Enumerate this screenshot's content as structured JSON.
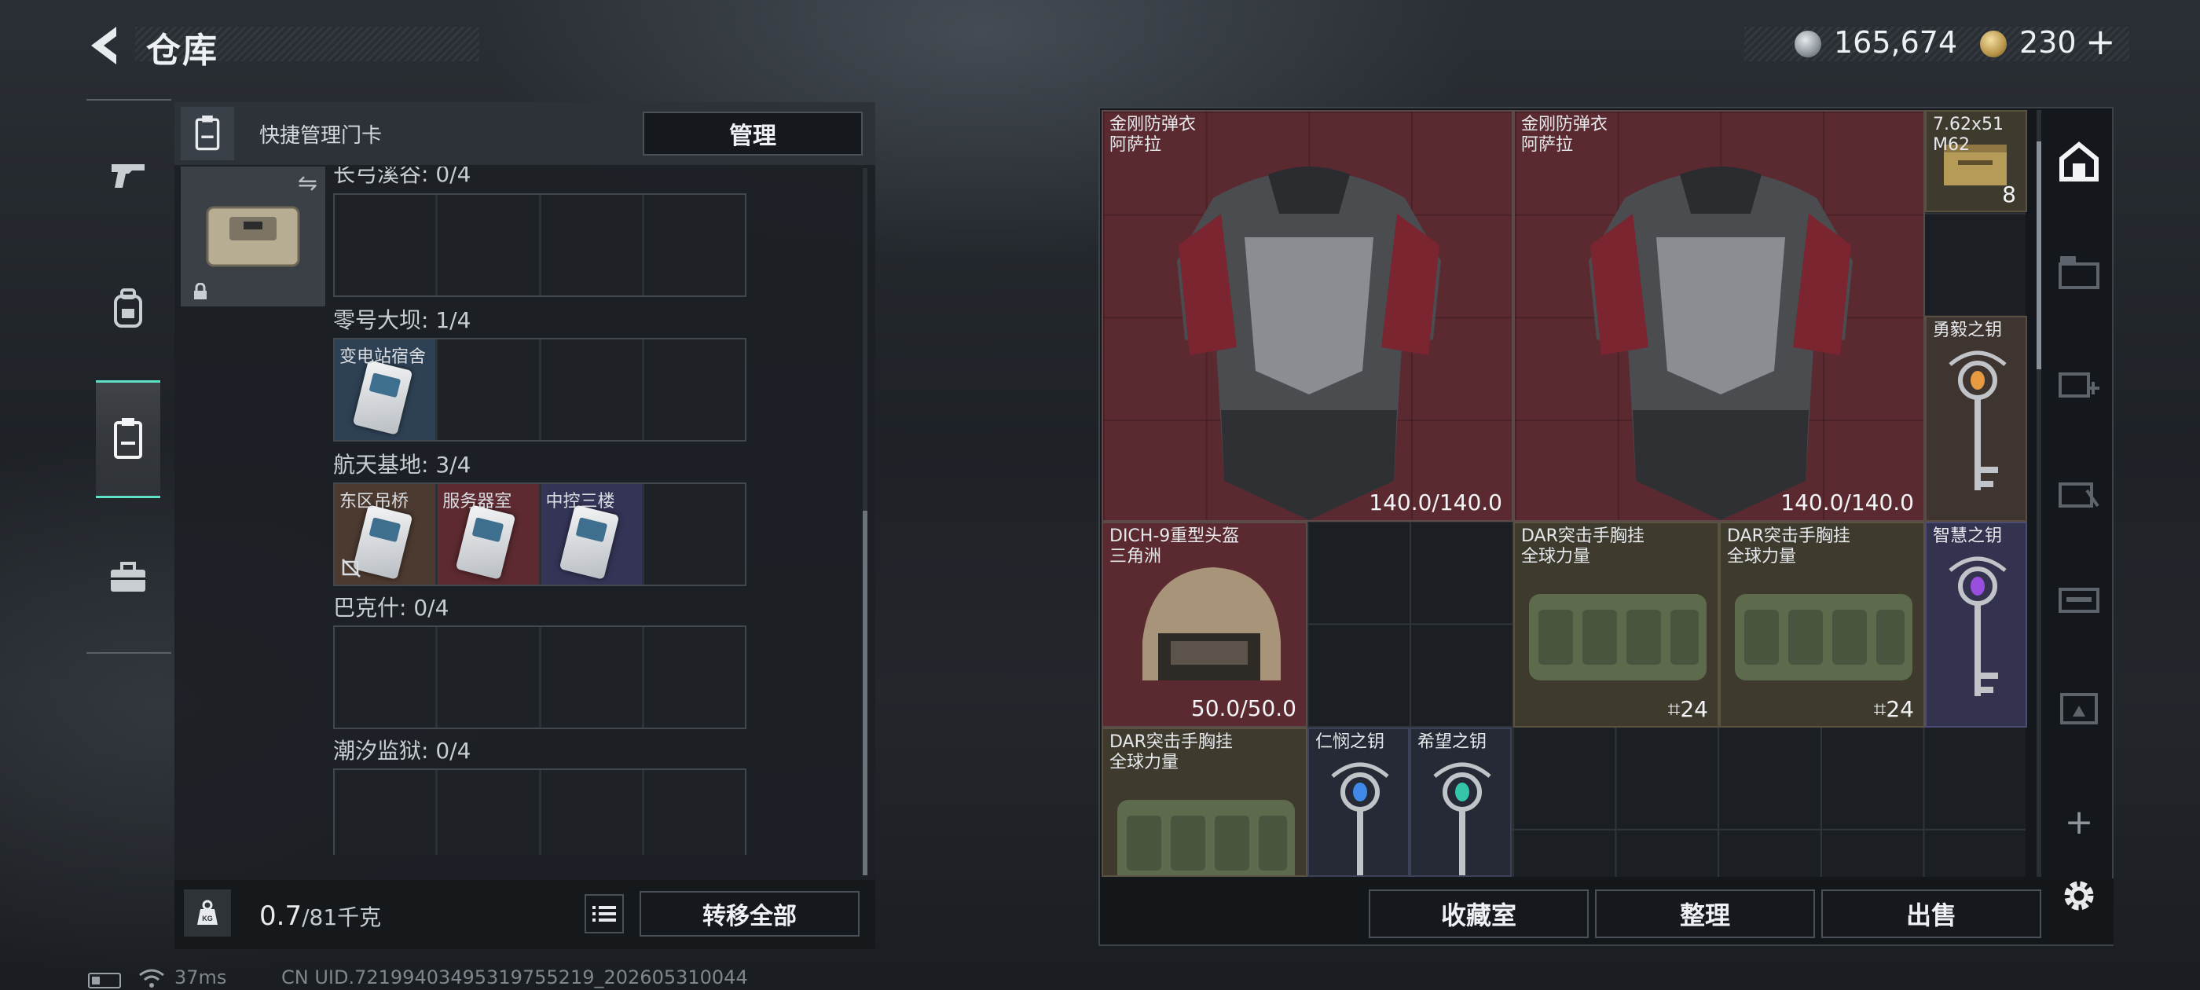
{
  "header": {
    "title": "仓库",
    "currency": [
      {
        "icon": "silver-coin-icon",
        "value": "165,674"
      },
      {
        "icon": "gold-coin-icon",
        "value": "230"
      }
    ],
    "plus": "+"
  },
  "left_tabs": [
    "pistol-icon",
    "backpack-icon",
    "keycard-icon",
    "briefcase-icon"
  ],
  "storage": {
    "header_label": "快捷管理门卡",
    "manage_label": "管理",
    "regions": [
      {
        "label": "长弓溪谷: 0/4",
        "slots": []
      },
      {
        "label": "零号大坝: 1/4",
        "slots": [
          {
            "name": "变电站宿舍",
            "color": "keycard"
          }
        ]
      },
      {
        "label": "航天基地: 3/4",
        "slots": [
          {
            "name": "东区吊桥",
            "color": "brown"
          },
          {
            "name": "服务器室",
            "color": "red"
          },
          {
            "name": "中控三楼",
            "color": "purple"
          }
        ]
      },
      {
        "label": "巴克什: 0/4",
        "slots": []
      },
      {
        "label": "潮汐监狱: 0/4",
        "slots": []
      }
    ],
    "weight_value": "0.7",
    "weight_unit": "/81千克",
    "transfer_label": "转移全部"
  },
  "inventory": {
    "items": [
      {
        "name1": "金刚防弹衣",
        "name2": "阿萨拉",
        "durability": "140.0/140.0"
      },
      {
        "name1": "金刚防弹衣",
        "name2": "阿萨拉",
        "durability": "140.0/140.0"
      },
      {
        "name1": "7.62x51",
        "name2": "M62",
        "count": "8"
      },
      {
        "name1": "勇毅之钥"
      },
      {
        "name1": "DICH-9重型头盔",
        "name2": "三角洲",
        "durability": "50.0/50.0"
      },
      {
        "name1": "DAR突击手胸挂",
        "name2": "全球力量",
        "count": "24"
      },
      {
        "name1": "DAR突击手胸挂",
        "name2": "全球力量",
        "count": "24"
      },
      {
        "name1": "智慧之钥"
      },
      {
        "name1": "DAR突击手胸挂",
        "name2": "全球力量"
      },
      {
        "name1": "仁悯之钥"
      },
      {
        "name1": "希望之钥"
      }
    ],
    "buttons": {
      "collection": "收藏室",
      "sort": "整理",
      "sell": "出售"
    }
  },
  "status_bar": {
    "ping": "37ms",
    "uid": "CN UID.7219940349531975521​9_202605310044"
  },
  "colors": {
    "accent": "#5fe1c8",
    "armor_bg": "#5a2a30",
    "rig_bg": "#3f3a2e",
    "key_purple_bg": "#333350"
  }
}
